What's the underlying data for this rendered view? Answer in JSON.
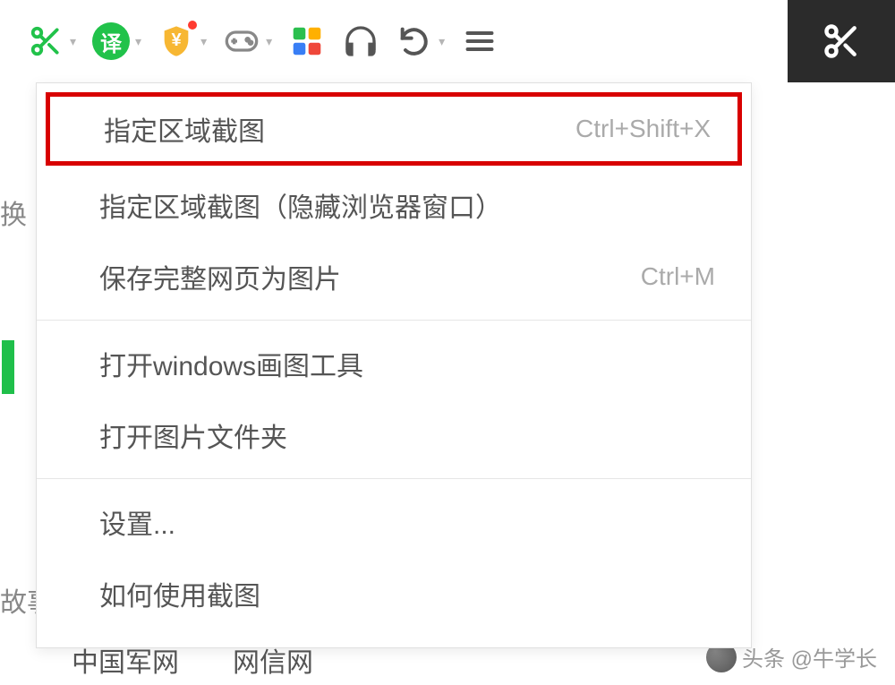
{
  "toolbar": {
    "scissors_icon": "scissors",
    "translate_char": "译",
    "shield_char": "¥",
    "gamepad_icon": "gamepad",
    "grid_icon": "grid",
    "headphones_icon": "headphones",
    "undo_icon": "undo",
    "menu_icon": "menu",
    "side_scissors": "scissors"
  },
  "menu": {
    "items": [
      {
        "label": "指定区域截图",
        "shortcut": "Ctrl+Shift+X",
        "highlight": true
      },
      {
        "label": "指定区域截图（隐藏浏览器窗口）",
        "shortcut": ""
      },
      {
        "label": "保存完整网页为图片",
        "shortcut": "Ctrl+M"
      },
      {
        "sep": true
      },
      {
        "label": "打开windows画图工具",
        "shortcut": ""
      },
      {
        "label": "打开图片文件夹",
        "shortcut": ""
      },
      {
        "sep": true
      },
      {
        "label": "设置...",
        "shortcut": ""
      },
      {
        "label": "如何使用截图",
        "shortcut": ""
      }
    ]
  },
  "background": {
    "left1": "换",
    "left2": "故事",
    "link1": "中国军网",
    "link2": "网信网"
  },
  "watermark": {
    "text": "头条 @牛学长"
  }
}
